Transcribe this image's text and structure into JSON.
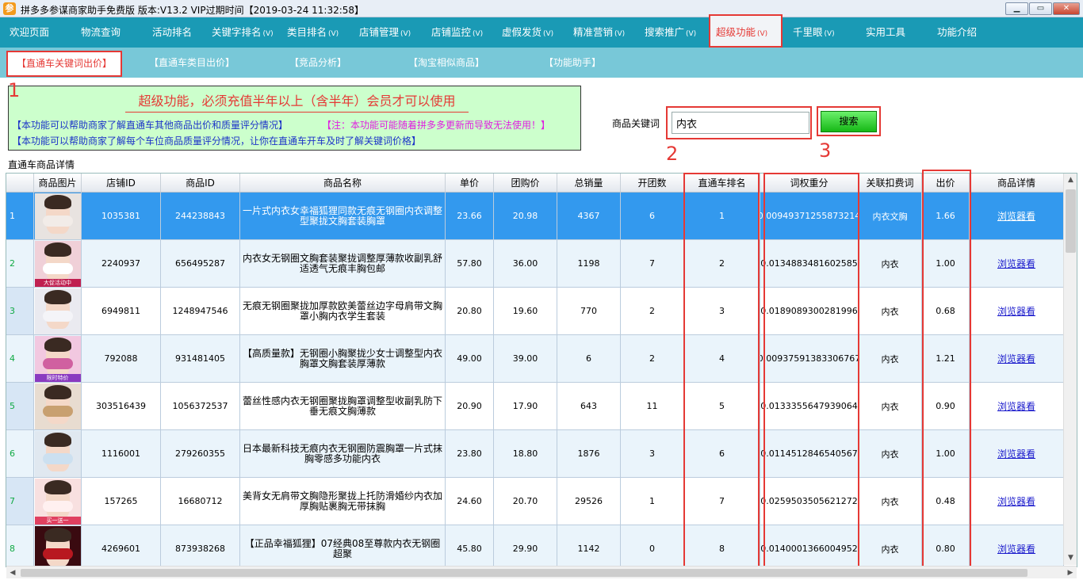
{
  "window": {
    "title": "拼多多参谋商家助手免费版 版本:V13.2 VIP过期时间【2019-03-24 11:32:58】",
    "icon": "app-logo-icon",
    "controls": {
      "min": "▁",
      "max": "▭",
      "close": "✕"
    }
  },
  "mainmenu": [
    {
      "label": "欢迎页面",
      "arrow": ""
    },
    {
      "label": "物流查询",
      "arrow": ""
    },
    {
      "label": "活动排名",
      "arrow": ""
    },
    {
      "label": "关键字排名",
      "arrow": "(V)"
    },
    {
      "label": "类目排名",
      "arrow": "(V)"
    },
    {
      "label": "店铺管理",
      "arrow": "(V)"
    },
    {
      "label": "店铺监控",
      "arrow": "(V)"
    },
    {
      "label": "虚假发货",
      "arrow": "(V)"
    },
    {
      "label": "精准营销",
      "arrow": "(V)"
    },
    {
      "label": "搜索推广",
      "arrow": "(V)"
    },
    {
      "label": "超级功能",
      "arrow": "(V)",
      "active": true
    },
    {
      "label": "千里眼",
      "arrow": "(V)"
    },
    {
      "label": "实用工具",
      "arrow": ""
    },
    {
      "label": "功能介绍",
      "arrow": ""
    }
  ],
  "subtabs": [
    {
      "label": "【直通车关键词出价】",
      "active": true
    },
    {
      "label": "【直通车类目出价】"
    },
    {
      "label": "【竞品分析】"
    },
    {
      "label": "【淘宝相似商品】"
    },
    {
      "label": "【功能助手】"
    }
  ],
  "notice": {
    "title": "超级功能，必须充值半年以上（含半年）会员才可以使用",
    "line1": "【本功能可以帮助商家了解直通车其他商品出价和质量评分情况】",
    "line1_note": "【注：本功能可能随着拼多多更新而导致无法使用！】",
    "line2": "【本功能可以帮助商家了解每个车位商品质量评分情况，让你在直通车开车及时了解关键词价格】"
  },
  "annotations": {
    "a1": "1",
    "a2": "2",
    "a3": "3"
  },
  "search": {
    "label": "商品关键词",
    "value": "内衣",
    "button": "搜索"
  },
  "group_title": "直通车商品详情",
  "table": {
    "headers": [
      "",
      "商品图片",
      "店铺ID",
      "商品ID",
      "商品名称",
      "单价",
      "团购价",
      "总销量",
      "开团数",
      "直通车排名",
      "词权重分",
      "关联扣费词",
      "出价",
      "商品详情"
    ],
    "rows": [
      {
        "n": "1",
        "shop": "1035381",
        "goods": "244238843",
        "name": "一片式内衣女幸福狐狸同款无痕无钢圈内衣调整型聚拢文胸套装胸罩",
        "price": "23.66",
        "group": "20.98",
        "sales": "4367",
        "groups": "6",
        "rank": "1",
        "weight": "0.00949371255873214",
        "word": "内衣文胸",
        "bid": "1.66",
        "link": "浏览器看",
        "selected": true
      },
      {
        "n": "2",
        "shop": "2240937",
        "goods": "656495287",
        "name": "内衣女无钢圈文胸套装聚拢调整厚薄款收副乳舒适透气无痕丰胸包邮",
        "price": "57.80",
        "group": "36.00",
        "sales": "1198",
        "groups": "7",
        "rank": "2",
        "weight": "0.0134883481602585",
        "word": "内衣",
        "bid": "1.00",
        "link": "浏览器看"
      },
      {
        "n": "3",
        "shop": "6949811",
        "goods": "1248947546",
        "name": "无痕无钢圈聚拢加厚款欧美蕾丝边字母肩带文胸罩小胸内衣学生套装",
        "price": "20.80",
        "group": "19.60",
        "sales": "770",
        "groups": "2",
        "rank": "3",
        "weight": "0.0189089300281996",
        "word": "内衣",
        "bid": "0.68",
        "link": "浏览器看"
      },
      {
        "n": "4",
        "shop": "792088",
        "goods": "931481405",
        "name": "【高质量款】无钢圈小胸聚拢少女士调整型内衣胸罩文胸套装厚薄款",
        "price": "49.00",
        "group": "39.00",
        "sales": "6",
        "groups": "2",
        "rank": "4",
        "weight": "0.00937591383306767",
        "word": "内衣",
        "bid": "1.21",
        "link": "浏览器看"
      },
      {
        "n": "5",
        "shop": "303516439",
        "goods": "1056372537",
        "name": "蕾丝性感内衣无钢圈聚拢胸罩调整型收副乳防下垂无痕文胸薄款",
        "price": "20.90",
        "group": "17.90",
        "sales": "643",
        "groups": "11",
        "rank": "5",
        "weight": "0.0133355647939064",
        "word": "内衣",
        "bid": "0.90",
        "link": "浏览器看"
      },
      {
        "n": "6",
        "shop": "1116001",
        "goods": "279260355",
        "name": "日本最新科技无痕内衣无钢圈防震胸罩一片式抹胸零感多功能内衣",
        "price": "23.80",
        "group": "18.80",
        "sales": "1876",
        "groups": "3",
        "rank": "6",
        "weight": "0.0114512846540567",
        "word": "内衣",
        "bid": "1.00",
        "link": "浏览器看"
      },
      {
        "n": "7",
        "shop": "157265",
        "goods": "16680712",
        "name": "美背女无肩带文胸隐形聚拢上托防滑婚纱内衣加厚胸贴裹胸无带抹胸",
        "price": "24.60",
        "group": "20.70",
        "sales": "29526",
        "groups": "1",
        "rank": "7",
        "weight": "0.0259503505621272",
        "word": "内衣",
        "bid": "0.48",
        "link": "浏览器看"
      },
      {
        "n": "8",
        "shop": "4269601",
        "goods": "873938268",
        "name": "【正品幸福狐狸】07经典08至尊款内衣无钢圈超聚",
        "price": "45.80",
        "group": "29.90",
        "sales": "1142",
        "groups": "0",
        "rank": "8",
        "weight": "0.0140001366004952",
        "word": "内衣",
        "bid": "0.80",
        "link": "浏览器看"
      }
    ],
    "thumb_labels": [
      "",
      "大促活动中",
      "",
      "限时特价",
      "",
      "",
      "买一送一",
      ""
    ]
  },
  "colors": {
    "menu": "#1a9ab5",
    "subtabs": "#78c8d8",
    "accent": "#e53935",
    "selected": "#3399ee",
    "notice_bg": "#ccffcc"
  }
}
